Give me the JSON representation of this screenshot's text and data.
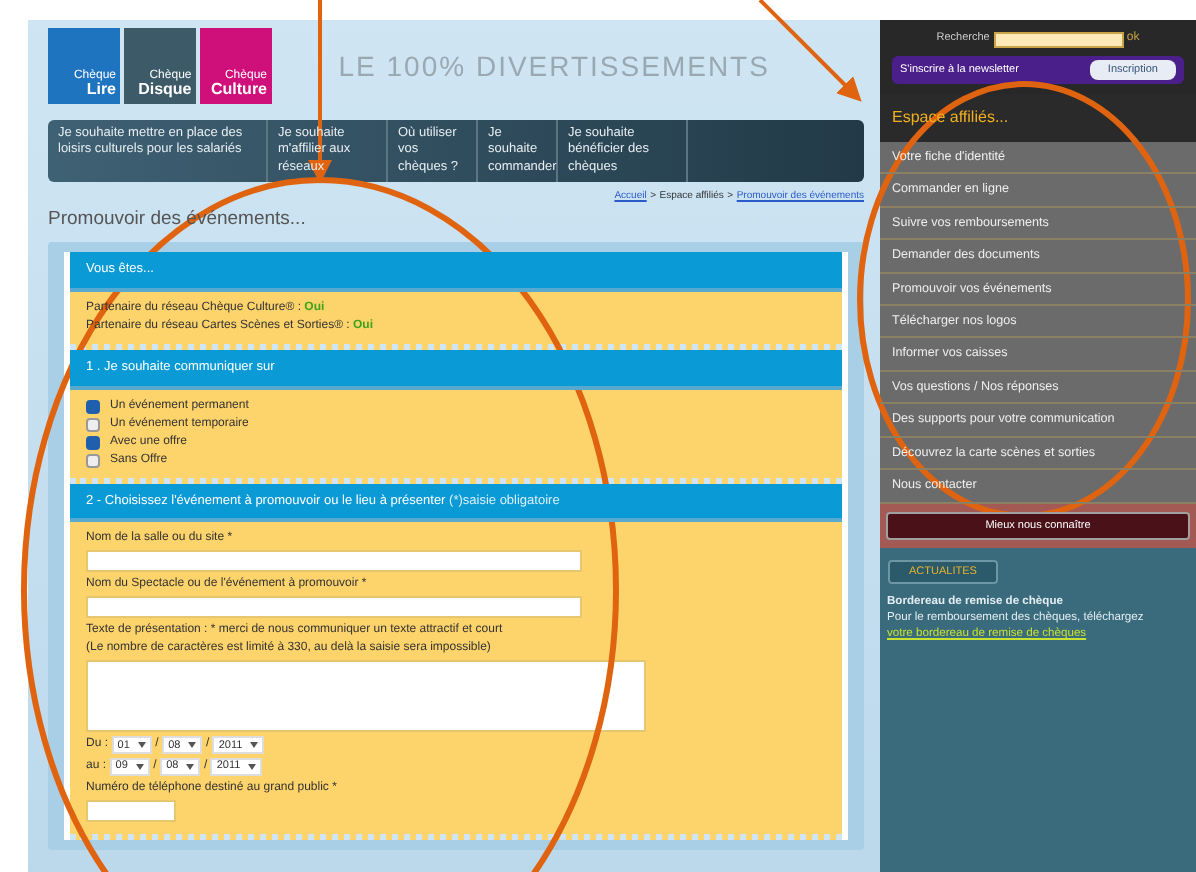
{
  "header": {
    "logos": [
      {
        "line1": "Chèque",
        "line2": "Lire",
        "color": "#1f74c0"
      },
      {
        "line1": "Chèque",
        "line2": "Disque",
        "color": "#3c5a68"
      },
      {
        "line1": "Chèque",
        "line2": "Culture",
        "color": "#d0107a"
      }
    ],
    "tagline": "LE 100% DIVERTISSEMENTS"
  },
  "nav": [
    {
      "label": "Je souhaite mettre en place des loisirs culturels pour les salariés"
    },
    {
      "label": "Je souhaite m'affilier aux réseaux"
    },
    {
      "label": "Où utiliser vos chèques ?"
    },
    {
      "label": "Je souhaite commander"
    },
    {
      "label": "Je souhaite bénéficier des chèques"
    }
  ],
  "breadcrumb_separator": ">",
  "breadcrumb": [
    {
      "text": "Accueil",
      "link": true
    },
    {
      "text": "Espace affiliés",
      "link": false
    },
    {
      "text": "Promouvoir des événements",
      "link": true
    }
  ],
  "page_title": "Promouvoir des événements...",
  "status": {
    "title": "Vous êtes...",
    "lines": [
      {
        "label": "Partenaire du réseau Chèque Culture® :",
        "value": "Oui"
      },
      {
        "label": "Partenaire du réseau Cartes Scènes et Sorties® :",
        "value": "Oui"
      }
    ]
  },
  "section1": {
    "title": "1 . Je souhaite communiquer sur",
    "groups": [
      [
        {
          "label": "Un événement permanent",
          "selected": true
        },
        {
          "label": "Un événement temporaire",
          "selected": false
        }
      ],
      [
        {
          "label": "Avec une offre",
          "selected": true
        },
        {
          "label": "Sans Offre",
          "selected": false
        }
      ]
    ]
  },
  "section2": {
    "title": "2 - Choisissez l'événement à promouvoir ou le lieu à présenter",
    "note": "(*)saisie obligatoire",
    "fields": [
      {
        "kind": "text",
        "label": "Nom de la salle ou du site *"
      },
      {
        "kind": "text",
        "label": "Nom du Spectacle ou de l'événement à promouvoir *"
      },
      {
        "kind": "textarea",
        "label": "Texte de présentation : * merci de nous communiquer un texte attractif et court",
        "hint": "(Le nombre de caractères est limité à 330, au delà la saisie sera impossible)"
      },
      {
        "kind": "dates",
        "separator": "/",
        "rows": [
          {
            "label": "Du :",
            "day": "01",
            "month": "08",
            "year": "2011"
          },
          {
            "label": "au :",
            "day": "09",
            "month": "08",
            "year": "2011"
          }
        ]
      },
      {
        "kind": "short",
        "label": "Numéro de téléphone destiné au grand public *"
      }
    ]
  },
  "sidebar": {
    "search_label": "Recherche",
    "search_go": "ok",
    "newsletter_label": "S'inscrire à la newsletter",
    "newsletter_button": "Inscription",
    "heading": "Espace affiliés...",
    "menu": [
      {
        "label": "Votre fiche d'identité"
      },
      {
        "label": "Commander en ligne"
      },
      {
        "label": "Suivre vos remboursements"
      },
      {
        "label": "Demander des documents"
      },
      {
        "label": "Promouvoir vos événements"
      },
      {
        "label": "Télécharger nos logos"
      },
      {
        "label": "Informer vos caisses"
      },
      {
        "label": "Vos questions / Nos réponses"
      },
      {
        "label": "Des supports pour votre communication"
      },
      {
        "label": "Découvrez la carte scènes et sorties"
      },
      {
        "label": "Nous contacter"
      }
    ],
    "know_button": "Mieux nous connaître",
    "news_button": "ACTUALITES",
    "news_title": "Bordereau de remise de chèque",
    "news_text": "Pour le remboursement des chèques, téléchargez",
    "news_link": "votre bordereau de remise de chèques"
  }
}
